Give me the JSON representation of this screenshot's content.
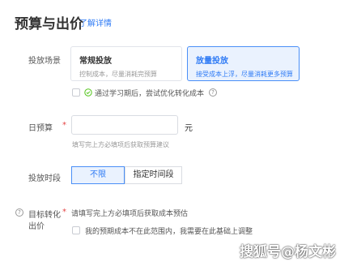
{
  "header": {
    "title": "预算与出价",
    "link": "了解详情"
  },
  "placement": {
    "label": "投放场景",
    "options": [
      {
        "title": "常规投放",
        "desc": "控制成本，尽量消耗完预算"
      },
      {
        "title": "放量投放",
        "desc": "接受成本上浮，尽量消耗更多预算"
      }
    ],
    "selected": 1,
    "learning_text": "通过学习期后，尝试优化转化成本"
  },
  "budget": {
    "label": "日预算",
    "required_mark": "*",
    "value": "",
    "unit": "元",
    "hint": "填写完上方必填项后获取预算建议"
  },
  "schedule": {
    "label": "投放时段",
    "options": [
      "不限",
      "指定时间段"
    ],
    "selected": 0
  },
  "target_cost": {
    "label_line1": "目标转化",
    "label_line2": "出价",
    "required_mark": "*",
    "hint": "请填写完上方必填项后获取成本预估",
    "checkbox_text": "我的预期成本不在此范围内，我需要在此基础上调整"
  },
  "watermark": "搜狐号@杨文彬",
  "colors": {
    "accent": "#2f7bf5",
    "required": "#e54545",
    "success": "#52c41a"
  }
}
